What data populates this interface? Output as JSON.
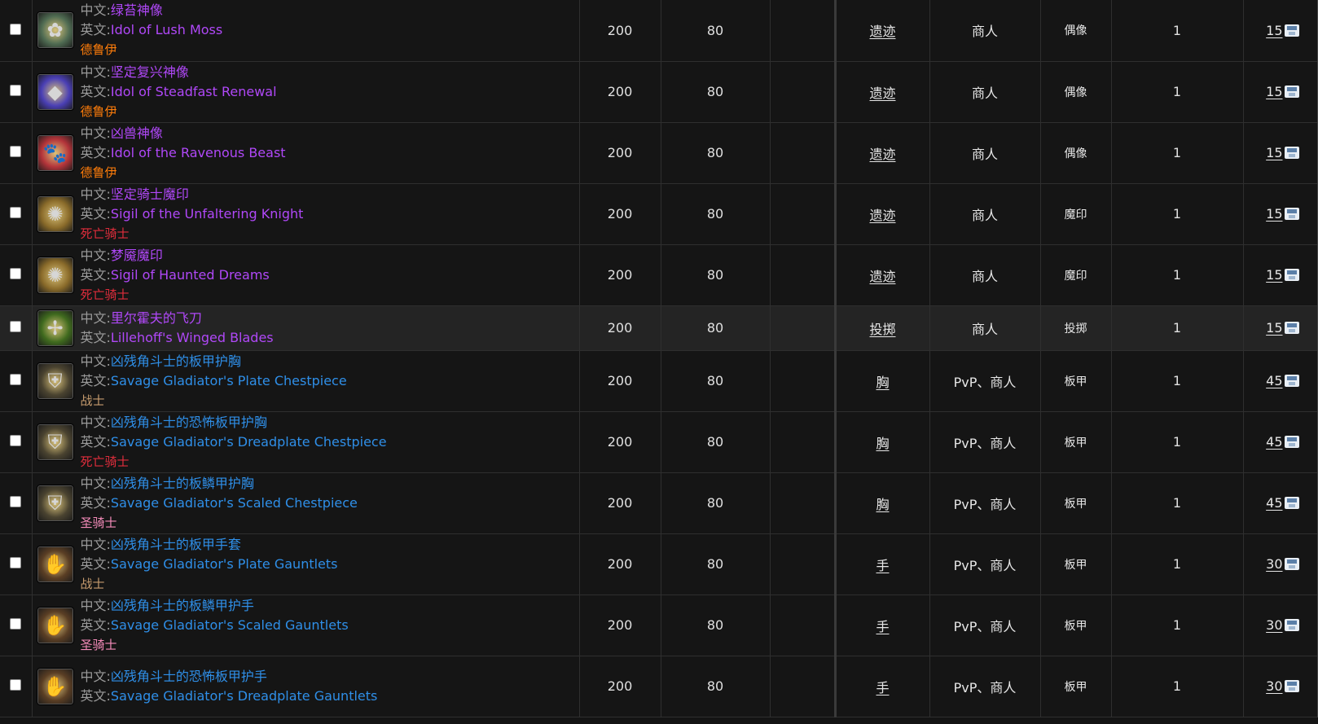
{
  "labels": {
    "cn": "中文:",
    "en": "英文:"
  },
  "rows": [
    {
      "cn": "绿苔神像",
      "en": "Idol of Lush Moss",
      "cls": "德鲁伊",
      "nameColor": "#b048f8",
      "clsColor": "#ff7d0a",
      "icon": "moss-idol-icon",
      "iconGlyph": "✿",
      "iconBg": "#4f6b52",
      "a": "200",
      "b": "80",
      "c": "",
      "cat": "遗迹",
      "src": "商人",
      "type": "偶像",
      "qty": "1",
      "price": "15"
    },
    {
      "cn": "坚定复兴神像",
      "en": "Idol of Steadfast Renewal",
      "cls": "德鲁伊",
      "nameColor": "#b048f8",
      "clsColor": "#ff7d0a",
      "icon": "crystal-idol-icon",
      "iconGlyph": "◆",
      "iconBg": "#4a3fb5",
      "a": "200",
      "b": "80",
      "c": "",
      "cat": "遗迹",
      "src": "商人",
      "type": "偶像",
      "qty": "1",
      "price": "15"
    },
    {
      "cn": "凶兽神像",
      "en": "Idol of the Ravenous Beast",
      "cls": "德鲁伊",
      "nameColor": "#b048f8",
      "clsColor": "#ff7d0a",
      "icon": "paw-idol-icon",
      "iconGlyph": "🐾",
      "iconBg": "#b3343a",
      "a": "200",
      "b": "80",
      "c": "",
      "cat": "遗迹",
      "src": "商人",
      "type": "偶像",
      "qty": "1",
      "price": "15"
    },
    {
      "cn": "坚定骑士魔印",
      "en": "Sigil of the Unfaltering Knight",
      "cls": "死亡骑士",
      "nameColor": "#b048f8",
      "clsColor": "#e02d3c",
      "icon": "sigil-icon",
      "iconGlyph": "✺",
      "iconBg": "#8a6b2a",
      "a": "200",
      "b": "80",
      "c": "",
      "cat": "遗迹",
      "src": "商人",
      "type": "魔印",
      "qty": "1",
      "price": "15"
    },
    {
      "cn": "梦魇魔印",
      "en": "Sigil of Haunted Dreams",
      "cls": "死亡骑士",
      "nameColor": "#b048f8",
      "clsColor": "#e02d3c",
      "icon": "sigil-icon",
      "iconGlyph": "✺",
      "iconBg": "#8a6b2a",
      "a": "200",
      "b": "80",
      "c": "",
      "cat": "遗迹",
      "src": "商人",
      "type": "魔印",
      "qty": "1",
      "price": "15"
    },
    {
      "cn": "里尔霍夫的飞刀",
      "en": "Lillehoff's Winged Blades",
      "cls": "",
      "nameColor": "#b048f8",
      "clsColor": "#e02d3c",
      "icon": "throwing-blades-icon",
      "iconGlyph": "✢",
      "iconBg": "#3f6a1e",
      "a": "200",
      "b": "80",
      "c": "",
      "cat": "投掷",
      "src": "商人",
      "type": "投掷",
      "qty": "1",
      "price": "15",
      "highlight": true
    },
    {
      "cn": "凶残角斗士的板甲护胸",
      "en": "Savage Gladiator's Plate Chestpiece",
      "cls": "战士",
      "nameColor": "#2f8fe8",
      "clsColor": "#c79c6e",
      "icon": "chest-armor-icon",
      "iconGlyph": "⛨",
      "iconBg": "#4a4330",
      "a": "200",
      "b": "80",
      "c": "",
      "cat": "胸",
      "src": "PvP、商人",
      "type": "板甲",
      "qty": "1",
      "price": "45"
    },
    {
      "cn": "凶残角斗士的恐怖板甲护胸",
      "en": "Savage Gladiator's Dreadplate Chestpiece",
      "cls": "死亡骑士",
      "nameColor": "#2f8fe8",
      "clsColor": "#e02d3c",
      "icon": "chest-armor-icon",
      "iconGlyph": "⛨",
      "iconBg": "#4a4330",
      "a": "200",
      "b": "80",
      "c": "",
      "cat": "胸",
      "src": "PvP、商人",
      "type": "板甲",
      "qty": "1",
      "price": "45"
    },
    {
      "cn": "凶残角斗士的板鳞甲护胸",
      "en": "Savage Gladiator's Scaled Chestpiece",
      "cls": "圣骑士",
      "nameColor": "#2f8fe8",
      "clsColor": "#f58cba",
      "icon": "chest-armor-icon",
      "iconGlyph": "⛨",
      "iconBg": "#4a4330",
      "a": "200",
      "b": "80",
      "c": "",
      "cat": "胸",
      "src": "PvP、商人",
      "type": "板甲",
      "qty": "1",
      "price": "45"
    },
    {
      "cn": "凶残角斗士的板甲手套",
      "en": "Savage Gladiator's Plate Gauntlets",
      "cls": "战士",
      "nameColor": "#2f8fe8",
      "clsColor": "#c79c6e",
      "icon": "gauntlets-icon",
      "iconGlyph": "✋",
      "iconBg": "#5a3e24",
      "a": "200",
      "b": "80",
      "c": "",
      "cat": "手",
      "src": "PvP、商人",
      "type": "板甲",
      "qty": "1",
      "price": "30"
    },
    {
      "cn": "凶残角斗士的板鳞甲护手",
      "en": "Savage Gladiator's Scaled Gauntlets",
      "cls": "圣骑士",
      "nameColor": "#2f8fe8",
      "clsColor": "#f58cba",
      "icon": "gauntlets-icon",
      "iconGlyph": "✋",
      "iconBg": "#5a3e24",
      "a": "200",
      "b": "80",
      "c": "",
      "cat": "手",
      "src": "PvP、商人",
      "type": "板甲",
      "qty": "1",
      "price": "30"
    },
    {
      "cn": "凶残角斗士的恐怖板甲护手",
      "en": "Savage Gladiator's Dreadplate Gauntlets",
      "cls": "",
      "nameColor": "#2f8fe8",
      "clsColor": "#e02d3c",
      "icon": "gauntlets-icon",
      "iconGlyph": "✋",
      "iconBg": "#5a3e24",
      "a": "200",
      "b": "80",
      "c": "",
      "cat": "手",
      "src": "PvP、商人",
      "type": "板甲",
      "qty": "1",
      "price": "30"
    }
  ]
}
